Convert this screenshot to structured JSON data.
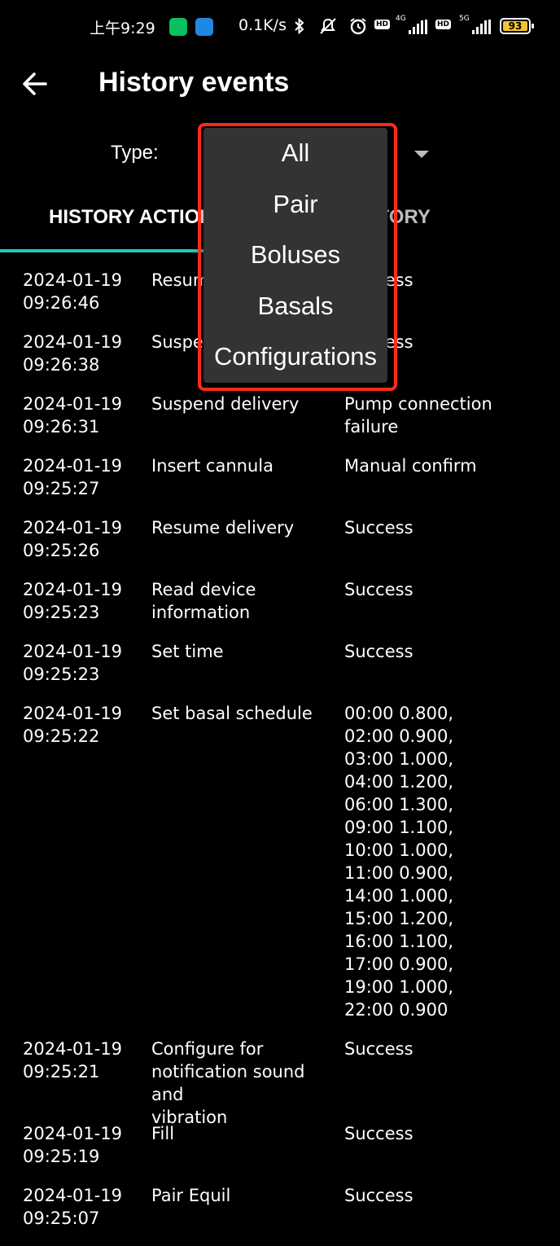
{
  "status_bar": {
    "time": "上午9:29",
    "net_speed": "0.1K/s",
    "hd1": "HD",
    "net1": "4G",
    "hd2": "HD",
    "net2": "5G",
    "battery": "93",
    "colors": {
      "battery_fill": "#f1c232",
      "wechat": "#07c160"
    }
  },
  "header": {
    "title": "History events"
  },
  "filter": {
    "label": "Type:"
  },
  "tabs": [
    {
      "label": "HISTORY ACTIONS",
      "active": true
    },
    {
      "label": "EQUIL HISTORY",
      "active": false
    }
  ],
  "rows": [
    {
      "date": "2024-01-19\n09:26:46",
      "action": "Resume delivery",
      "result": "Success"
    },
    {
      "date": "2024-01-19\n09:26:38",
      "action": "Suspend delivery",
      "result": "Success"
    },
    {
      "date": "2024-01-19\n09:26:31",
      "action": "Suspend delivery",
      "result": "Pump connection\nfailure"
    },
    {
      "date": "2024-01-19\n09:25:27",
      "action": "Insert cannula",
      "result": "Manual confirm"
    },
    {
      "date": "2024-01-19\n09:25:26",
      "action": "Resume delivery",
      "result": "Success"
    },
    {
      "date": "2024-01-19\n09:25:23",
      "action": "Read device\ninformation",
      "result": "Success"
    },
    {
      "date": "2024-01-19\n09:25:23",
      "action": "Set time",
      "result": "Success"
    },
    {
      "date": "2024-01-19\n09:25:22",
      "action": "Set basal schedule",
      "result": "00:00 0.800,\n02:00 0.900,\n03:00 1.000,\n04:00 1.200,\n06:00 1.300,\n09:00 1.100,\n10:00 1.000,\n11:00 0.900,\n14:00 1.000,\n15:00 1.200,\n16:00 1.100,\n17:00 0.900,\n19:00 1.000,\n22:00 0.900"
    },
    {
      "date": "2024-01-19\n09:25:21",
      "action": "Configure for\nnotification sound and\nvibration",
      "result": "Success"
    },
    {
      "date": "2024-01-19\n09:25:19",
      "action": "Fill",
      "result": "Success"
    },
    {
      "date": "2024-01-19\n09:25:07",
      "action": "Pair Equil",
      "result": "Success"
    }
  ],
  "dropdown": {
    "options": [
      "All",
      "Pair",
      "Boluses",
      "Basals",
      "Configurations"
    ]
  },
  "accent_color": "#26c6b5",
  "highlight_color": "#ff2a1a"
}
